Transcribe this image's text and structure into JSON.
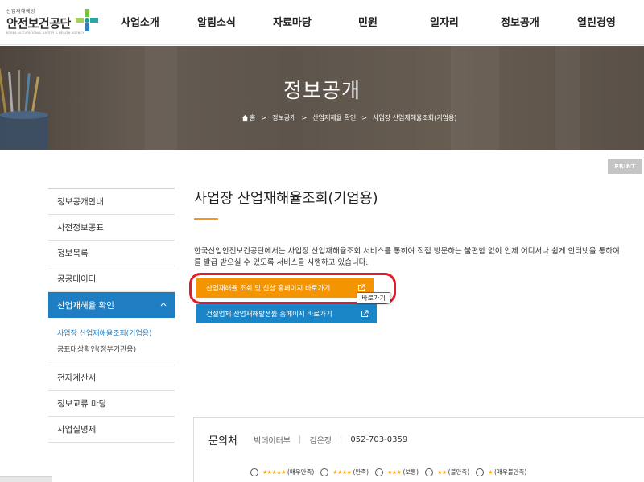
{
  "logo": {
    "small": "산업재해예방",
    "name": "안전보건공단",
    "sub": "KOREA OCCUPATIONAL SAFETY & HEALTH AGENCY"
  },
  "gnb": [
    "사업소개",
    "알림소식",
    "자료마당",
    "민원",
    "일자리",
    "정보공개",
    "열린경영"
  ],
  "banner": {
    "title": "정보공개",
    "breadcrumb": [
      "홈",
      "정보공개",
      "산업재해율 확인",
      "사업장 산업재해율조회(기업용)"
    ]
  },
  "print_label": "PRINT",
  "lnb": {
    "items": [
      "정보공개안내",
      "사전정보공표",
      "정보목록",
      "공공데이터",
      "산업재해율 확인"
    ],
    "sub": [
      "사업장 산업재해율조회(기업용)",
      "공표대상확인(정부기관용)"
    ],
    "items_after": [
      "전자계산서",
      "정보교류 마당",
      "사업실명제"
    ]
  },
  "content": {
    "title": "사업장 산업재해율조회(기업용)",
    "desc_line1": "한국산업안전보건공단에서는 사업장 산업재해율조회 서비스를 통하여 직접 방문하는 불편함 없이 언제 어디서나 쉽게 인터넷을 통하여",
    "desc_line2": "를 발급 받으실 수 있도록 서비스를 시행하고 있습니다.",
    "btn_primary": "산업재해율 조회 및 신청 홈페이지 바로가기",
    "btn_secondary": "건설업체 산업재해발생률 홈페이지 바로가기",
    "tooltip": "바로가기"
  },
  "contact": {
    "label": "문의처",
    "dept": "빅데이터부",
    "person": "김은정",
    "phone": "052-703-0359"
  },
  "rating": [
    {
      "stars": "★★★★★",
      "label": "(매우만족)"
    },
    {
      "stars": "★★★★",
      "label": "(만족)"
    },
    {
      "stars": "★★★",
      "label": "(보통)"
    },
    {
      "stars": "★★",
      "label": "(불만족)"
    },
    {
      "stars": "★",
      "label": "(매우불만족)"
    }
  ],
  "colors": {
    "accent_orange": "#f39400",
    "accent_blue": "#1a86c8",
    "active_nav": "#1f7ec2",
    "highlight_ring": "#e11d2a"
  }
}
